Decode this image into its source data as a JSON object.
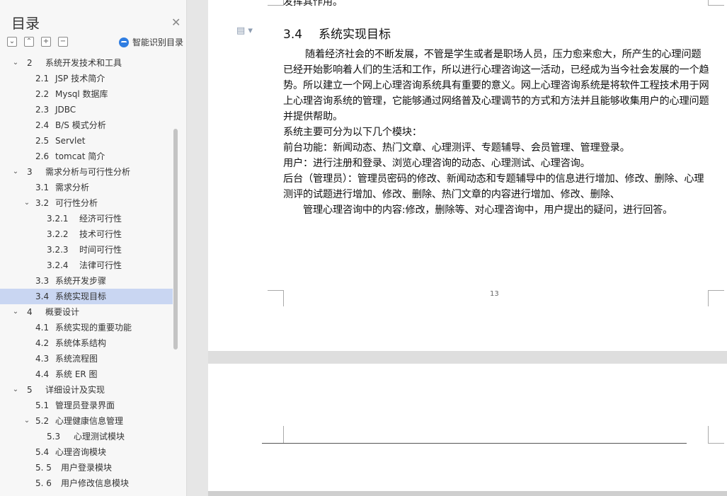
{
  "sidebar": {
    "title": "目录",
    "close_icon": "close-icon",
    "smart_toc_label": "智能识别目录",
    "toc": [
      {
        "num": "2",
        "label": "系统开发技术和工具",
        "level": 1,
        "expanded": true
      },
      {
        "num": "2.1",
        "label": "JSP 技术简介",
        "level": 2
      },
      {
        "num": "2.2",
        "label": "Mysql 数据库",
        "level": 2
      },
      {
        "num": "2.3",
        "label": "JDBC",
        "level": 2
      },
      {
        "num": "2.4",
        "label": "B/S 模式分析",
        "level": 2
      },
      {
        "num": "2.5",
        "label": "Servlet",
        "level": 2
      },
      {
        "num": "2.6",
        "label": "tomcat 简介",
        "level": 2
      },
      {
        "num": "3",
        "label": "需求分析与可行性分析",
        "level": 1,
        "expanded": true
      },
      {
        "num": "3.1",
        "label": "需求分析",
        "level": 2
      },
      {
        "num": "3.2",
        "label": "可行性分析",
        "level": 2,
        "expanded": true
      },
      {
        "num": "3.2.1",
        "label": "经济可行性",
        "level": 3
      },
      {
        "num": "3.2.2",
        "label": "技术可行性",
        "level": 3
      },
      {
        "num": "3.2.3",
        "label": "时间可行性",
        "level": 3
      },
      {
        "num": "3.2.4",
        "label": "法律可行性",
        "level": 3
      },
      {
        "num": "3.3",
        "label": "系统开发步骤",
        "level": 2
      },
      {
        "num": "3.4",
        "label": "系统实现目标",
        "level": 2,
        "selected": true
      },
      {
        "num": "4",
        "label": "概要设计",
        "level": 1,
        "expanded": true
      },
      {
        "num": "4.1",
        "label": "系统实现的重要功能",
        "level": 2
      },
      {
        "num": "4.2",
        "label": "系统体系结构",
        "level": 2
      },
      {
        "num": "4.3",
        "label": "系统流程图",
        "level": 2
      },
      {
        "num": "4.4",
        "label": "系统 ER 图",
        "level": 2
      },
      {
        "num": "5",
        "label": "详细设计及实现",
        "level": 1,
        "expanded": true
      },
      {
        "num": "5.1",
        "label": "管理员登录界面",
        "level": 2
      },
      {
        "num": "5.2",
        "label": "心理健康信息管理",
        "level": 2,
        "expanded": true
      },
      {
        "num": "5.3",
        "label": "心理测试模块",
        "level": 3
      },
      {
        "num": "5.4",
        "label": "心理咨询模块",
        "level": 2
      },
      {
        "num": "5. 5",
        "label": "用户登录模块",
        "level": 2
      },
      {
        "num": "5. 6",
        "label": "用户修改信息模块",
        "level": 2
      }
    ]
  },
  "document": {
    "top_cut_text": "发挥其作用。",
    "section_number": "3.4",
    "section_title": "系统实现目标",
    "paragraph1": "随着经济社会的不断发展，不管是学生或者是职场人员，压力愈来愈大，所产生的心理问题已经开始影响着人们的生活和工作，所以进行心理咨询这一活动，已经成为当今社会发展的一个趋势。所以建立一个网上心理咨询系统具有重要的意义。网上心理咨询系统是将软件工程技术用于网上心理咨询系统的管理，它能够通过网络普及心理调节的方式和方法并且能够收集用户的心理问题并提供帮助。",
    "line_modules": "系统主要可分为以下几个模块：",
    "line_frontend": "前台功能：新闻动态、热门文章、心理测评、专题辅导、会员管理、管理登录。",
    "line_user": "用户：进行注册和登录、浏览心理咨询的动态、心理测试、心理咨询。",
    "line_backend": "后台（管理员）：管理员密码的修改、新闻动态和专题辅导中的信息进行增加、修改、删除、心理测评的试题进行增加、修改、删除、热门文章的内容进行增加、修改、删除、",
    "line_manage": "管理心理咨询中的内容:修改，删除等、对心理咨询中，用户提出的疑问，进行回答。",
    "page_number": "13"
  }
}
